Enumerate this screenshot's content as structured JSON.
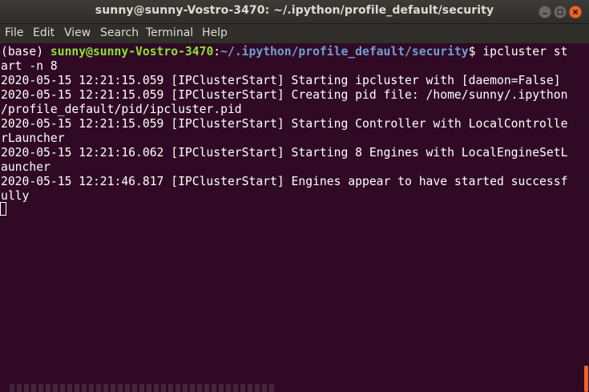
{
  "window": {
    "title": "sunny@sunny-Vostro-3470: ~/.ipython/profile_default/security"
  },
  "menu": [
    "File",
    "Edit",
    "View",
    "Search",
    "Terminal",
    "Help"
  ],
  "terminal": {
    "prompt_env": "(base) ",
    "prompt_user": "sunny@sunny-Vostro-3470",
    "prompt_colon": ":",
    "prompt_path": "~/.ipython/profile_default/security",
    "prompt_symbol": "$ ",
    "command_part1": "ipcluster st",
    "command_part2": "art -n 8",
    "output": [
      "2020-05-15 12:21:15.059 [IPClusterStart] Starting ipcluster with [daemon=False]",
      "2020-05-15 12:21:15.059 [IPClusterStart] Creating pid file: /home/sunny/.ipython",
      "/profile_default/pid/ipcluster.pid",
      "2020-05-15 12:21:15.059 [IPClusterStart] Starting Controller with LocalControlle",
      "rLauncher",
      "2020-05-15 12:21:16.062 [IPClusterStart] Starting 8 Engines with LocalEngineSetL",
      "auncher",
      "2020-05-15 12:21:46.817 [IPClusterStart] Engines appear to have started successf",
      "ully"
    ]
  },
  "colors": {
    "background": "#300a24",
    "prompt_user": "#8ae234",
    "prompt_path": "#729fcf",
    "close_button": "#e9642f"
  },
  "icons": [
    "minimize-icon",
    "maximize-icon",
    "close-icon"
  ]
}
